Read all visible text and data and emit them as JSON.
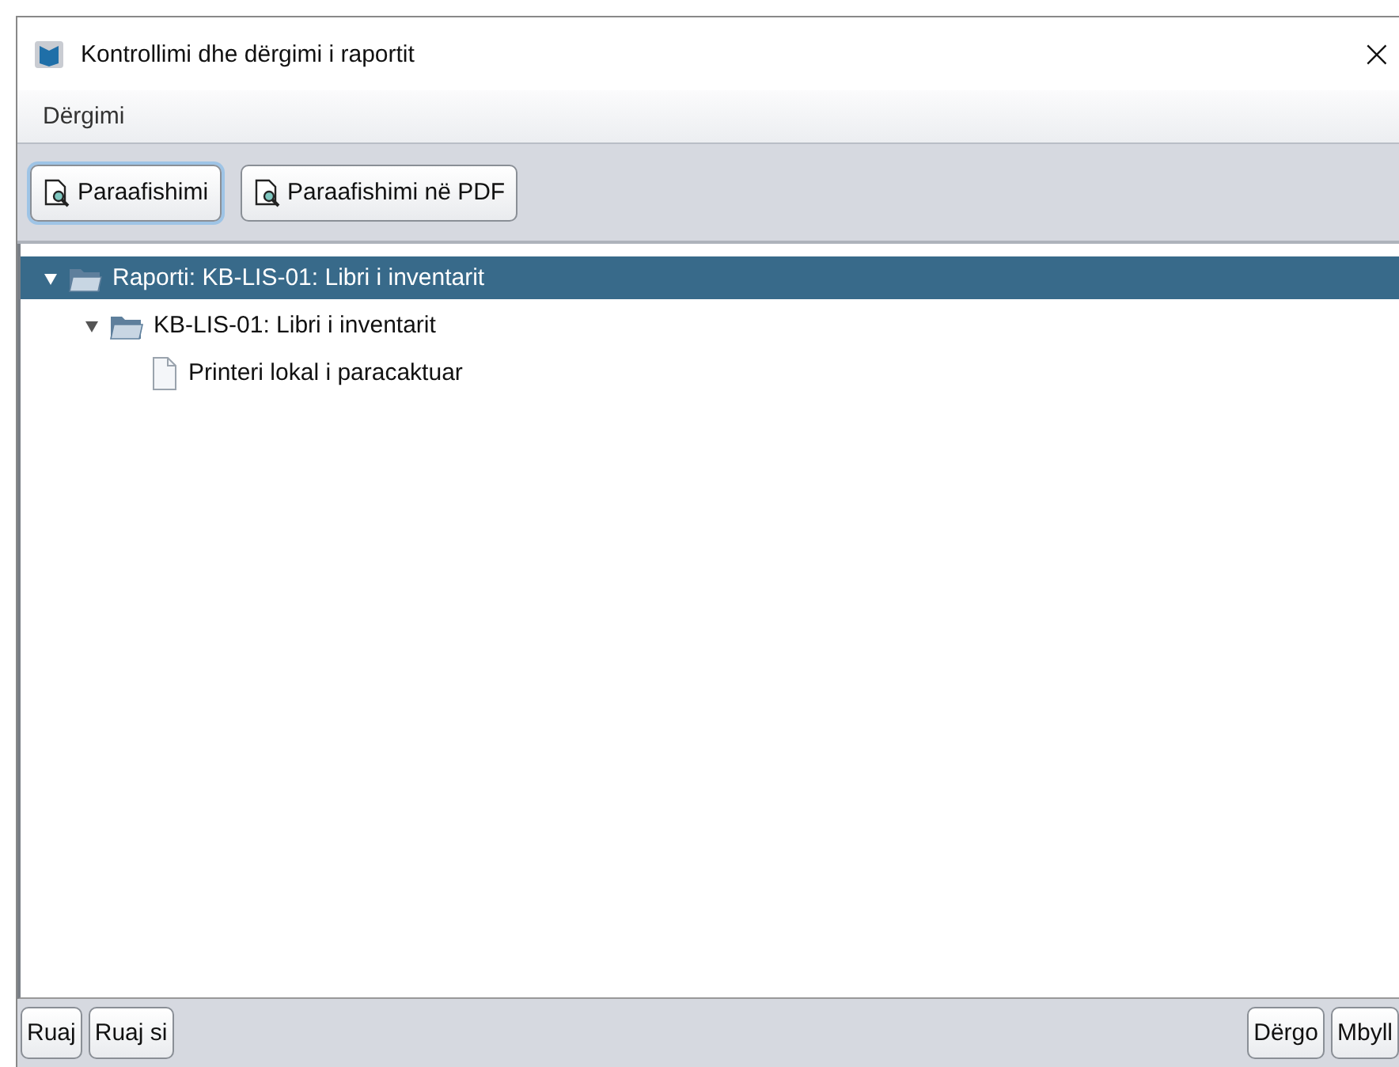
{
  "window": {
    "title": "Kontrollimi dhe dërgimi i raportit",
    "close": "×"
  },
  "menu": [
    {
      "label": "Dërgimi"
    }
  ],
  "toolbar": [
    {
      "label": "Paraafishimi",
      "focused": true
    },
    {
      "label": "Paraafishimi në PDF",
      "focused": false
    }
  ],
  "tree": [
    {
      "kind": "folder",
      "label": "Raporti: KB-LIS-01: Libri i inventarit",
      "expanded": true,
      "selected": true,
      "children": [
        {
          "kind": "folder",
          "label": "KB-LIS-01: Libri i inventarit",
          "expanded": true,
          "selected": false,
          "children": [
            {
              "kind": "file",
              "label": "Printeri lokal i paracaktuar",
              "selected": false
            }
          ]
        }
      ]
    }
  ],
  "footer_left": [
    "Ruaj",
    "Ruaj si"
  ],
  "footer_right": [
    "Dërgo",
    "Mbyll"
  ]
}
